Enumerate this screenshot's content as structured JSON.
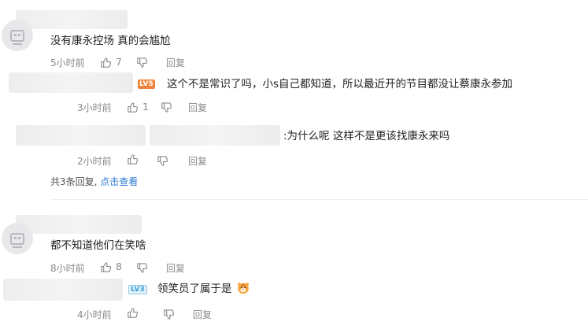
{
  "comments": [
    {
      "text": "没有康永控场 真的会尴尬",
      "time": "5小时前",
      "likes": "7",
      "dislike_icon": "thumbs-down-icon",
      "like_icon": "thumbs-up-icon",
      "reply_label": "回复"
    },
    {
      "text": "都不知道他们在笑啥",
      "time": "8小时前",
      "likes": "8",
      "reply_label": "回复"
    }
  ],
  "replies": [
    {
      "badge": "LV5",
      "text": "这个不是常识了吗，小s自己都知道，所以最近开的节目都没让蔡康永参加",
      "time": "3小时前",
      "likes": "1",
      "reply_label": "回复"
    },
    {
      "text": ":为什么呢 这样不是更该找康永来吗",
      "time": "2小时前",
      "likes": "",
      "reply_label": "回复"
    },
    {
      "badge": "LV3",
      "text": "领笑员了属于是",
      "emoji": "tiger-face-emoji",
      "time": "4小时前",
      "likes": "",
      "reply_label": "回复"
    }
  ],
  "thread_summary": {
    "count_text": "共3条回复,",
    "link_text": "点击查看"
  },
  "colors": {
    "link": "#2f7bd6",
    "meta": "#8a8a8a",
    "badge_orange": "#f0833a",
    "badge_blue": "#38a3d6"
  }
}
